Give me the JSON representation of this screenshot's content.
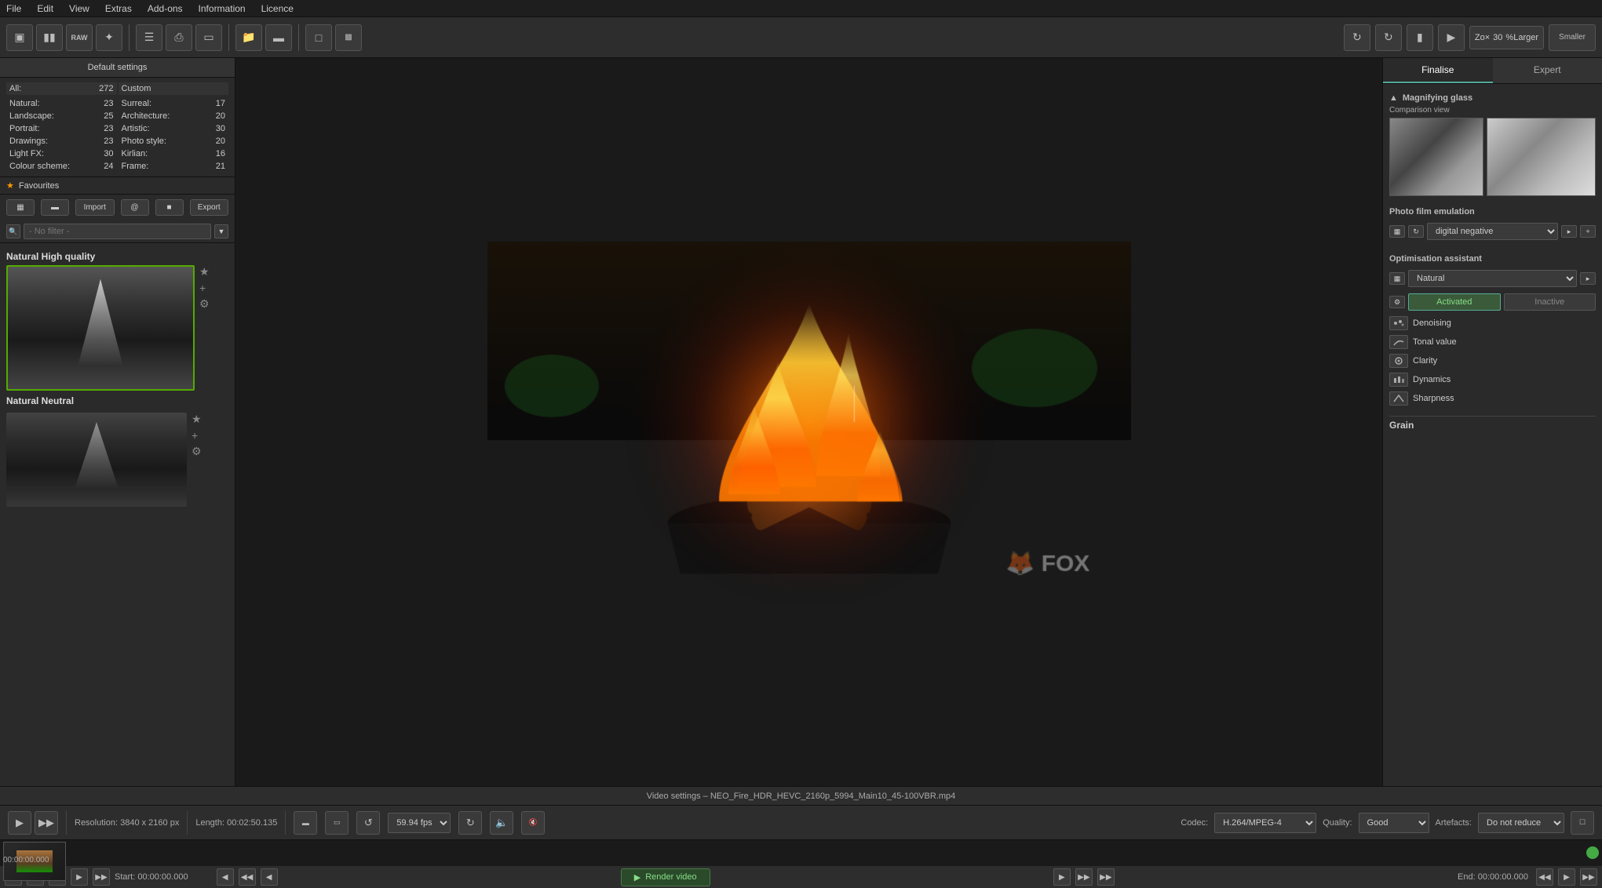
{
  "menu": {
    "items": [
      "File",
      "Edit",
      "View",
      "Extras",
      "Add-ons",
      "Information",
      "Licence"
    ]
  },
  "toolbar": {
    "zoom_label": "Zo×",
    "zoom_percent": "30",
    "zoom_larger": "%Larger",
    "smaller_label": "Smaller"
  },
  "left_panel": {
    "header": "Default settings",
    "all_label": "All:",
    "all_count": "272",
    "custom_label": "Custom",
    "categories": [
      {
        "label": "Natural:",
        "count": "23"
      },
      {
        "label": "Surreal:",
        "count": "17"
      },
      {
        "label": "Landscape:",
        "count": "25"
      },
      {
        "label": "Architecture:",
        "count": "20"
      },
      {
        "label": "Portrait:",
        "count": "23"
      },
      {
        "label": "Artistic:",
        "count": "30"
      },
      {
        "label": "Drawings:",
        "count": "23"
      },
      {
        "label": "Photo style:",
        "count": "20"
      },
      {
        "label": "Light FX:",
        "count": "30"
      },
      {
        "label": "Kirlian:",
        "count": "16"
      },
      {
        "label": "Colour scheme:",
        "count": "24"
      },
      {
        "label": "Frame:",
        "count": "21"
      }
    ],
    "favourites": "Favourites",
    "import_label": "Import",
    "at_label": "@",
    "export_label": "Export",
    "no_filter": "- No filter -",
    "natural_high_quality": "Natural High quality",
    "natural_neutral": "Natural Neutral"
  },
  "video": {
    "settings_title": "Video settings – NEO_Fire_HDR_HEVC_2160p_5994_Main10_45-100VBR.mp4",
    "resolution": "Resolution: 3840 x 2160 px",
    "length": "Length: 00:02:50.135",
    "fps": "59.94 fps",
    "codec_label": "Codec:",
    "codec_value": "H.264/MPEG-4",
    "quality_label": "Quality:",
    "quality_value": "Good",
    "artefacts_label": "Artefacts:",
    "artefacts_value": "Do not reduce"
  },
  "transport": {
    "start_time": "Start: 00:00:00.000",
    "end_time": "End: 00:00:00.000",
    "timecode": "00:00:00.000",
    "render_label": "Render video"
  },
  "right_panel": {
    "tab_finalise": "Finalise",
    "tab_expert": "Expert",
    "magnifying_glass": "Magnifying glass",
    "comparison_view": "Comparison view",
    "photo_film_label": "Photo film emulation",
    "photo_film_value": "digital negative",
    "optimisation_label": "Optimisation assistant",
    "optimisation_value": "Natural",
    "activated": "Activated",
    "inactive": "Inactive",
    "denoising": "Denoising",
    "tonal_value": "Tonal value",
    "clarity": "Clarity",
    "dynamics": "Dynamics",
    "sharpness": "Sharpness",
    "grain": "Grain"
  }
}
